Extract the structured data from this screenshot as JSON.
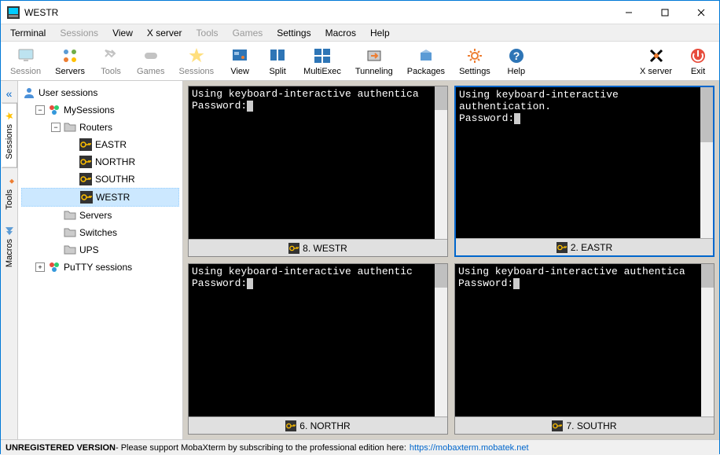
{
  "window": {
    "title": "WESTR"
  },
  "menubar": [
    {
      "label": "Terminal",
      "enabled": true
    },
    {
      "label": "Sessions",
      "enabled": false
    },
    {
      "label": "View",
      "enabled": true
    },
    {
      "label": "X server",
      "enabled": true
    },
    {
      "label": "Tools",
      "enabled": false
    },
    {
      "label": "Games",
      "enabled": false
    },
    {
      "label": "Settings",
      "enabled": true
    },
    {
      "label": "Macros",
      "enabled": true
    },
    {
      "label": "Help",
      "enabled": true
    }
  ],
  "toolbar": {
    "left": [
      {
        "label": "Session",
        "icon": "monitor",
        "enabled": false
      },
      {
        "label": "Servers",
        "icon": "servers",
        "enabled": true
      },
      {
        "label": "Tools",
        "icon": "tools",
        "enabled": false
      },
      {
        "label": "Games",
        "icon": "games",
        "enabled": false
      },
      {
        "label": "Sessions",
        "icon": "star",
        "enabled": false
      },
      {
        "label": "View",
        "icon": "view",
        "enabled": true
      },
      {
        "label": "Split",
        "icon": "split",
        "enabled": true
      },
      {
        "label": "MultiExec",
        "icon": "multiexec",
        "enabled": true
      },
      {
        "label": "Tunneling",
        "icon": "tunnel",
        "enabled": true
      },
      {
        "label": "Packages",
        "icon": "packages",
        "enabled": true
      },
      {
        "label": "Settings",
        "icon": "gear",
        "enabled": true
      },
      {
        "label": "Help",
        "icon": "help",
        "enabled": true
      }
    ],
    "right": [
      {
        "label": "X server",
        "icon": "xserver",
        "enabled": true
      },
      {
        "label": "Exit",
        "icon": "exit",
        "enabled": true
      }
    ]
  },
  "sidetabs": [
    {
      "label": "Sessions",
      "active": true
    },
    {
      "label": "Tools",
      "active": false
    },
    {
      "label": "Macros",
      "active": false
    }
  ],
  "tree": {
    "root": {
      "label": "User sessions"
    },
    "mysessions": {
      "label": "MySessions"
    },
    "routers": {
      "label": "Routers"
    },
    "routerItems": [
      {
        "label": "EASTR"
      },
      {
        "label": "NORTHR"
      },
      {
        "label": "SOUTHR"
      },
      {
        "label": "WESTR",
        "selected": true
      }
    ],
    "servers": {
      "label": "Servers"
    },
    "switches": {
      "label": "Switches"
    },
    "ups": {
      "label": "UPS"
    },
    "putty": {
      "label": "PuTTY sessions"
    }
  },
  "terminals": [
    {
      "tab": "8. WESTR",
      "line1": "Using keyboard-interactive authentica",
      "line2": "Password:",
      "active": false,
      "scrollThumb": 30
    },
    {
      "tab": "2. EASTR",
      "line1": "Using keyboard-interactive authentication.",
      "line2": "Password:",
      "active": true,
      "scrollThumb": 70
    },
    {
      "tab": "6. NORTHR",
      "line1": "Using keyboard-interactive authentic",
      "line2": "Password:",
      "active": false,
      "scrollThumb": 30
    },
    {
      "tab": "7. SOUTHR",
      "line1": "Using keyboard-interactive authentica",
      "line2": "Password:",
      "active": false,
      "scrollThumb": 30
    }
  ],
  "statusbar": {
    "bold": "UNREGISTERED VERSION",
    "text": " - Please support MobaXterm by subscribing to the professional edition here: ",
    "link": "https://mobaxterm.mobatek.net"
  }
}
